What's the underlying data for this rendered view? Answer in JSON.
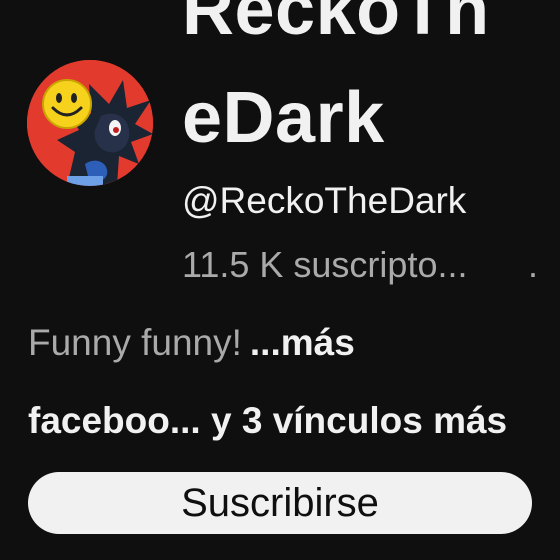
{
  "channel": {
    "name_line1": "ReckoTh",
    "name_line2": "eDark",
    "handle": "@ReckoTheDark",
    "subscribers": "11.5 K suscripto...",
    "subscribers_more": ".",
    "avatar_icon": "avatar-smiley-hedgehog-icon"
  },
  "description": {
    "text": "Funny funny!",
    "more_label": "...más"
  },
  "links": {
    "label": "faceboo... y 3 vínculos más"
  },
  "actions": {
    "subscribe_label": "Suscribirse"
  },
  "colors": {
    "background": "#0f0f0f",
    "primary_text": "#f1f1f1",
    "secondary_text": "#aaaaaa",
    "button_bg": "#f1f1f1",
    "avatar_bg": "#e23b2e"
  }
}
